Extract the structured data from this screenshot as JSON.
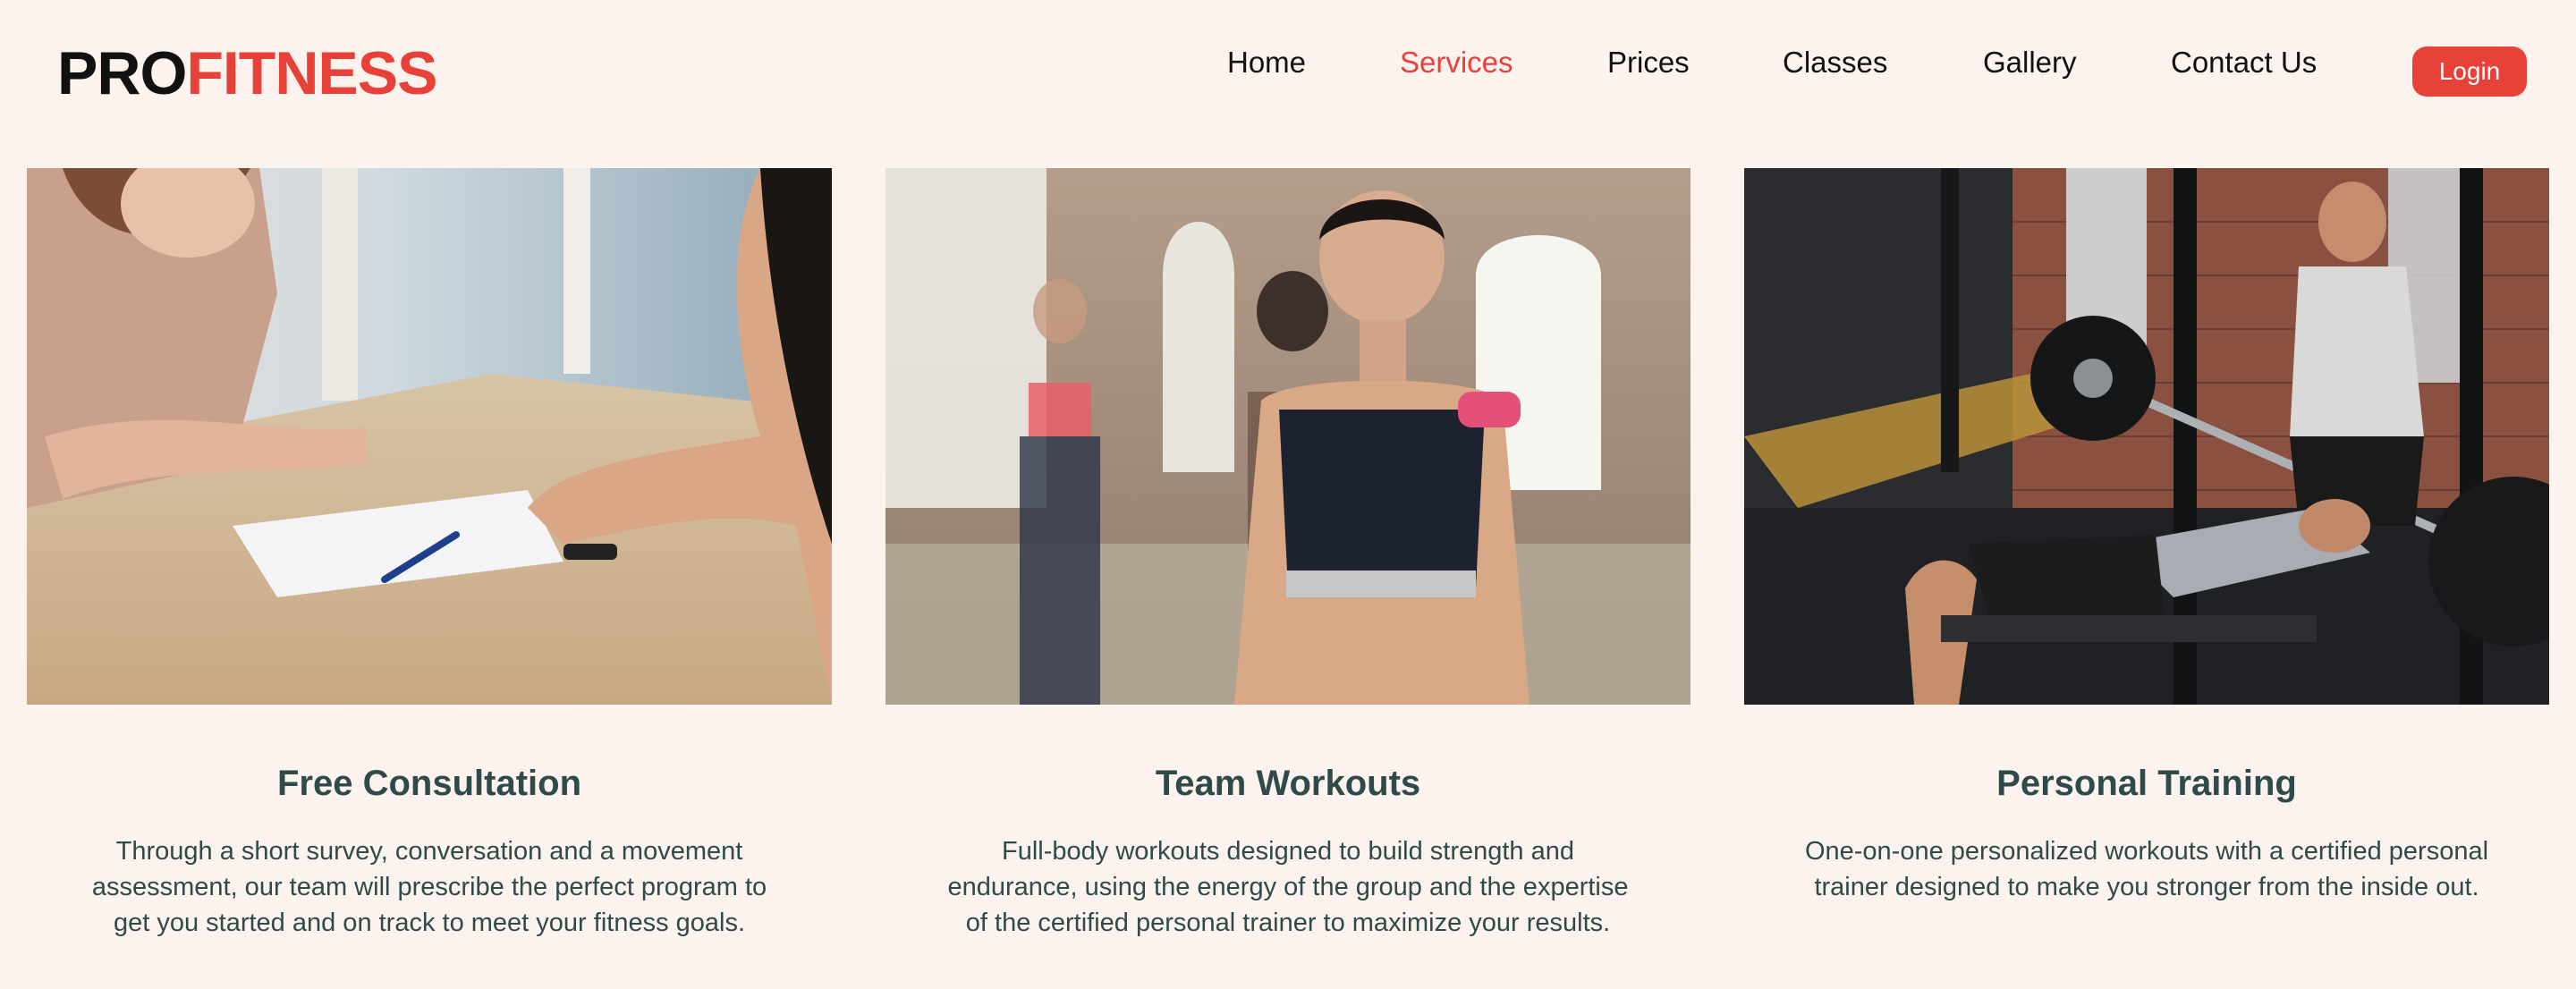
{
  "brand": {
    "part1": "PRO",
    "part2": "FITNESS",
    "color_dark": "#111111",
    "color_accent": "#e8413a"
  },
  "nav": {
    "items": [
      {
        "label": "Home",
        "active": false
      },
      {
        "label": "Services",
        "active": true
      },
      {
        "label": "Prices",
        "active": false
      },
      {
        "label": "Classes",
        "active": false
      },
      {
        "label": "Gallery",
        "active": false
      },
      {
        "label": "Contact Us",
        "active": false
      }
    ],
    "login_label": "Login"
  },
  "services": [
    {
      "title": "Free Consultation",
      "description": "Through a short survey, conversation and a movement assessment, our team will prescribe the perfect program to get you started and on track to meet your fitness goals."
    },
    {
      "title": "Team Workouts",
      "description": "Full-body workouts designed to build strength and endurance, using the energy of the group and the expertise of the certified personal trainer to maximize your results."
    },
    {
      "title": "Personal Training",
      "description": "One-on-one personalized workouts with a certified personal trainer designed to make you stronger from the inside out."
    }
  ],
  "colors": {
    "background": "#fdf3ee",
    "text": "#2f4a4a",
    "accent": "#e8413a"
  }
}
